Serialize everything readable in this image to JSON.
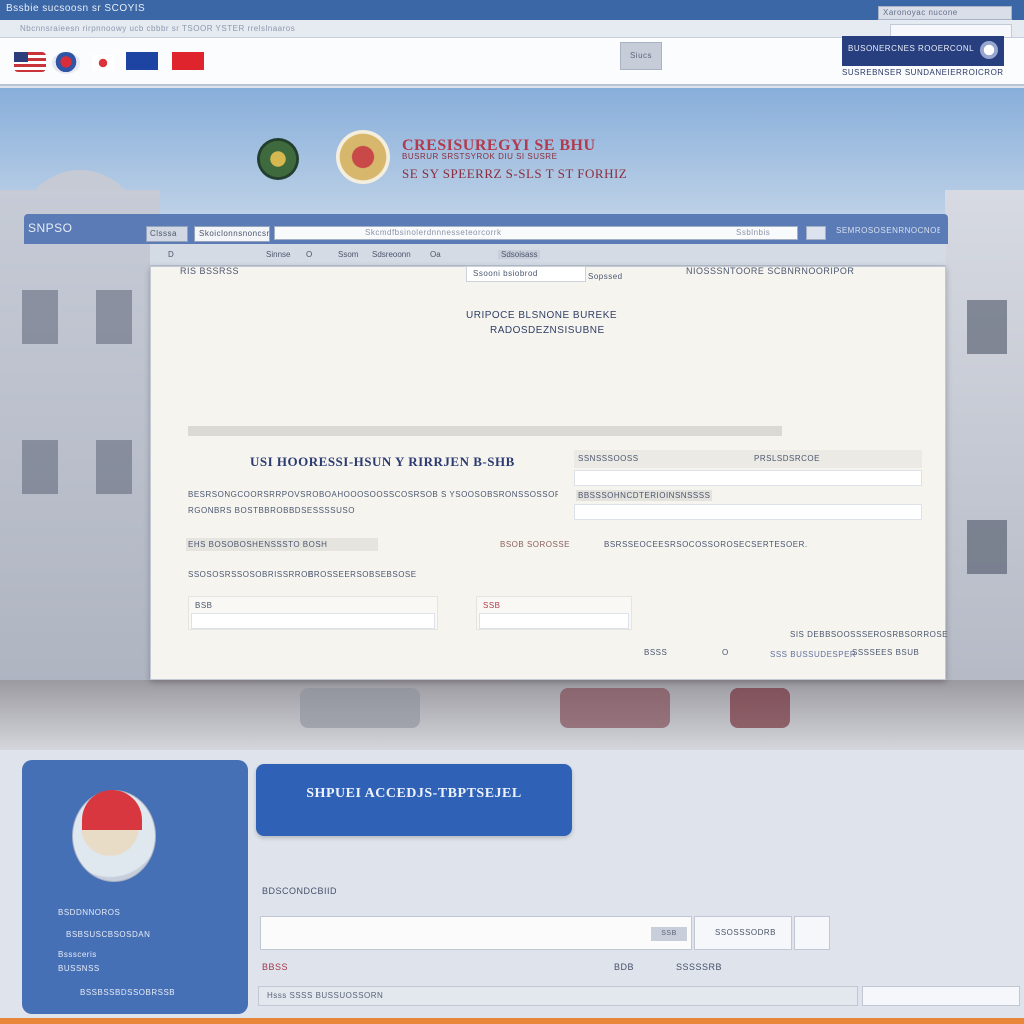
{
  "topbar": {
    "title": "Bssbie sucsoosn sr SCOYIS",
    "search": "Xaronoyac nucone"
  },
  "subbar": {
    "links": "Nbcnnsraieesn rirpnnoowy ucb cbbbr sr TSOOR YSTER rrelslnaaros"
  },
  "header": {
    "button": "Siucs",
    "brand": "BUSONERCNES ROOERCONL",
    "tagline": "SUSREBNSER SUNDANEIERROICROR"
  },
  "government": {
    "line1": "CRESISUREGYI SE BHU",
    "line1b": "BUSRUR SRSTSYROK DIU SI SUSRE",
    "line2": "SE SY SPEERRZ S-SLS T ST FORHIZ"
  },
  "window": {
    "title": "SNPSO",
    "tab1": "Clsssa",
    "tab2": "Skoiclonnsnoncsr",
    "url": "Skcmdfbsinolerdnnnesseteorcorrk",
    "url_right": "Ssblnbis",
    "right_title": "SEMROSOSENRNOCNOES",
    "toolbar": [
      "D",
      "Sinnse",
      "O",
      "Ssom",
      "Sdsreoonn",
      "Oa",
      "Sdsoisass"
    ],
    "row1_left": "RIS BSSRSS",
    "row1_mid": "Ssooni bsiobrod",
    "row1_mid2": "Sopssed",
    "row1_right": "NIOSSSNTOORE SCBNRNOORIPOR",
    "heading_1": "URIPOCE BLSNONE BUREKE",
    "heading_2": "RADOSDEZNSISUBNE",
    "form_title": "USI HOORESSI-HSUN Y RIRRJEN B-SHB",
    "field_a": "SSNSSSOOSS",
    "field_b": "PRSLSDSRCOE",
    "desc1": "BESRSONGCOORSRRPOVSROBOAHOOOSOOSSCOSRSOB S YSOOSOBSRONSSOSSORSSSORSSSSSO",
    "desc2": "RGONBRS BOSTBBROBBDSESSSSUSO",
    "field_c": "BBSSSOHNCDTERIOINSNSSSS",
    "link1": "EHS BOSOBOSHENSSSTO BOSH",
    "link2": "BSOB SOROSSE",
    "link3": "BSRSSEOCEESRSOCOSSOROSECSERTESOER.",
    "opt1": "SSOSOSRSSOSOBRISSRROE",
    "opt2": "BROSSEERSOBSEBSOSE",
    "in_label1": "BSB",
    "in_label2": "SSB",
    "foot1": "SIS DEBBSOOSSSEROSRBSORROSE",
    "foot2": "BSSS",
    "foot3": "O",
    "foot4": "SSS BUSSUDESPER",
    "foot5": "SSSSEES BSUB"
  },
  "card": {
    "line1": "BSDDNNOROS",
    "line2": "BSBSUSCBSOSDAN",
    "line3": "Bsssceris",
    "line4": "BUSSNSS",
    "line5": "BSSBSSBDSSOBRSSB"
  },
  "cta": {
    "label": "SHPUEI ACCEDJS-TBPTSEJEL"
  },
  "bottom": {
    "label": "BDSCONDCBIID",
    "tag": "SSB",
    "select": "SSOSSSODRB",
    "row1": "BBSS",
    "row2": "BDB",
    "row3": "SSSSSRB",
    "input2": "Hsss SSSS BUSSUOSSORN"
  },
  "colors": {
    "topbar": "#3b67a6",
    "window": "#5a7bb5",
    "card": "#4670b6",
    "cta": "#2f62b6",
    "accent_bar": "#e8873a"
  }
}
